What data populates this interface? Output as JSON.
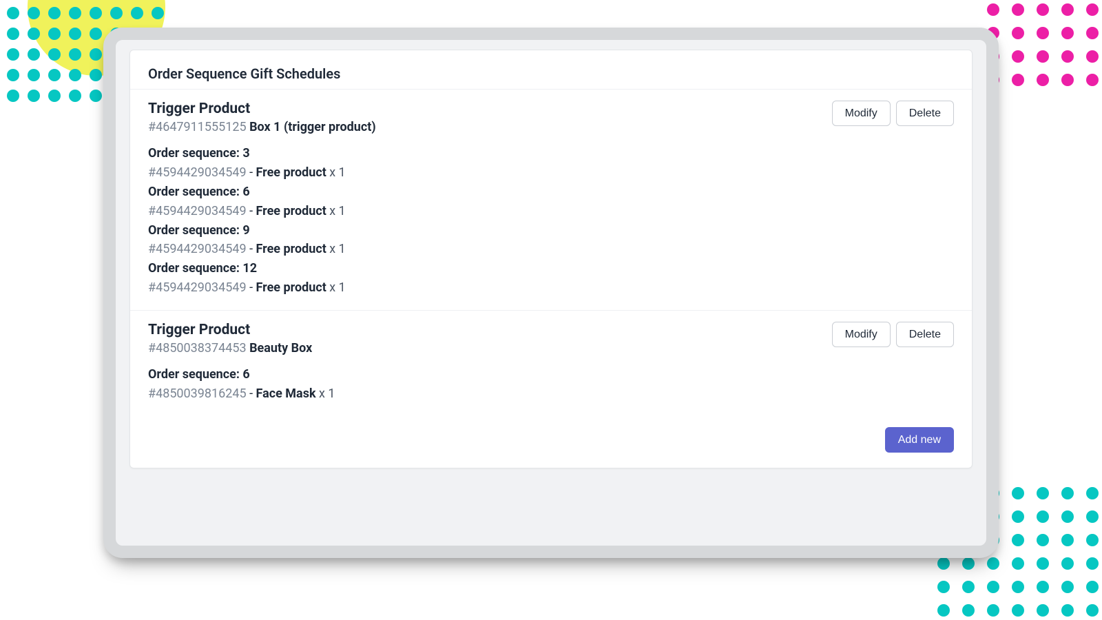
{
  "page_title": "Order Sequence Gift Schedules",
  "labels": {
    "trigger_heading": "Trigger Product",
    "modify": "Modify",
    "delete": "Delete",
    "add_new": "Add new",
    "order_sequence_prefix": "Order sequence: "
  },
  "schedules": [
    {
      "trigger": {
        "id": "#4647911555125",
        "name": "Box 1 (trigger product)"
      },
      "sequences": [
        {
          "n": "3",
          "gift_id": "#4594429034549",
          "gift_name": "Free product",
          "qty": "x 1"
        },
        {
          "n": "6",
          "gift_id": "#4594429034549",
          "gift_name": "Free product",
          "qty": "x 1"
        },
        {
          "n": "9",
          "gift_id": "#4594429034549",
          "gift_name": "Free product",
          "qty": "x 1"
        },
        {
          "n": "12",
          "gift_id": "#4594429034549",
          "gift_name": "Free product",
          "qty": "x 1"
        }
      ]
    },
    {
      "trigger": {
        "id": "#4850038374453",
        "name": "Beauty Box"
      },
      "sequences": [
        {
          "n": "6",
          "gift_id": "#4850039816245",
          "gift_name": "Face Mask",
          "qty": "x 1"
        }
      ]
    }
  ]
}
